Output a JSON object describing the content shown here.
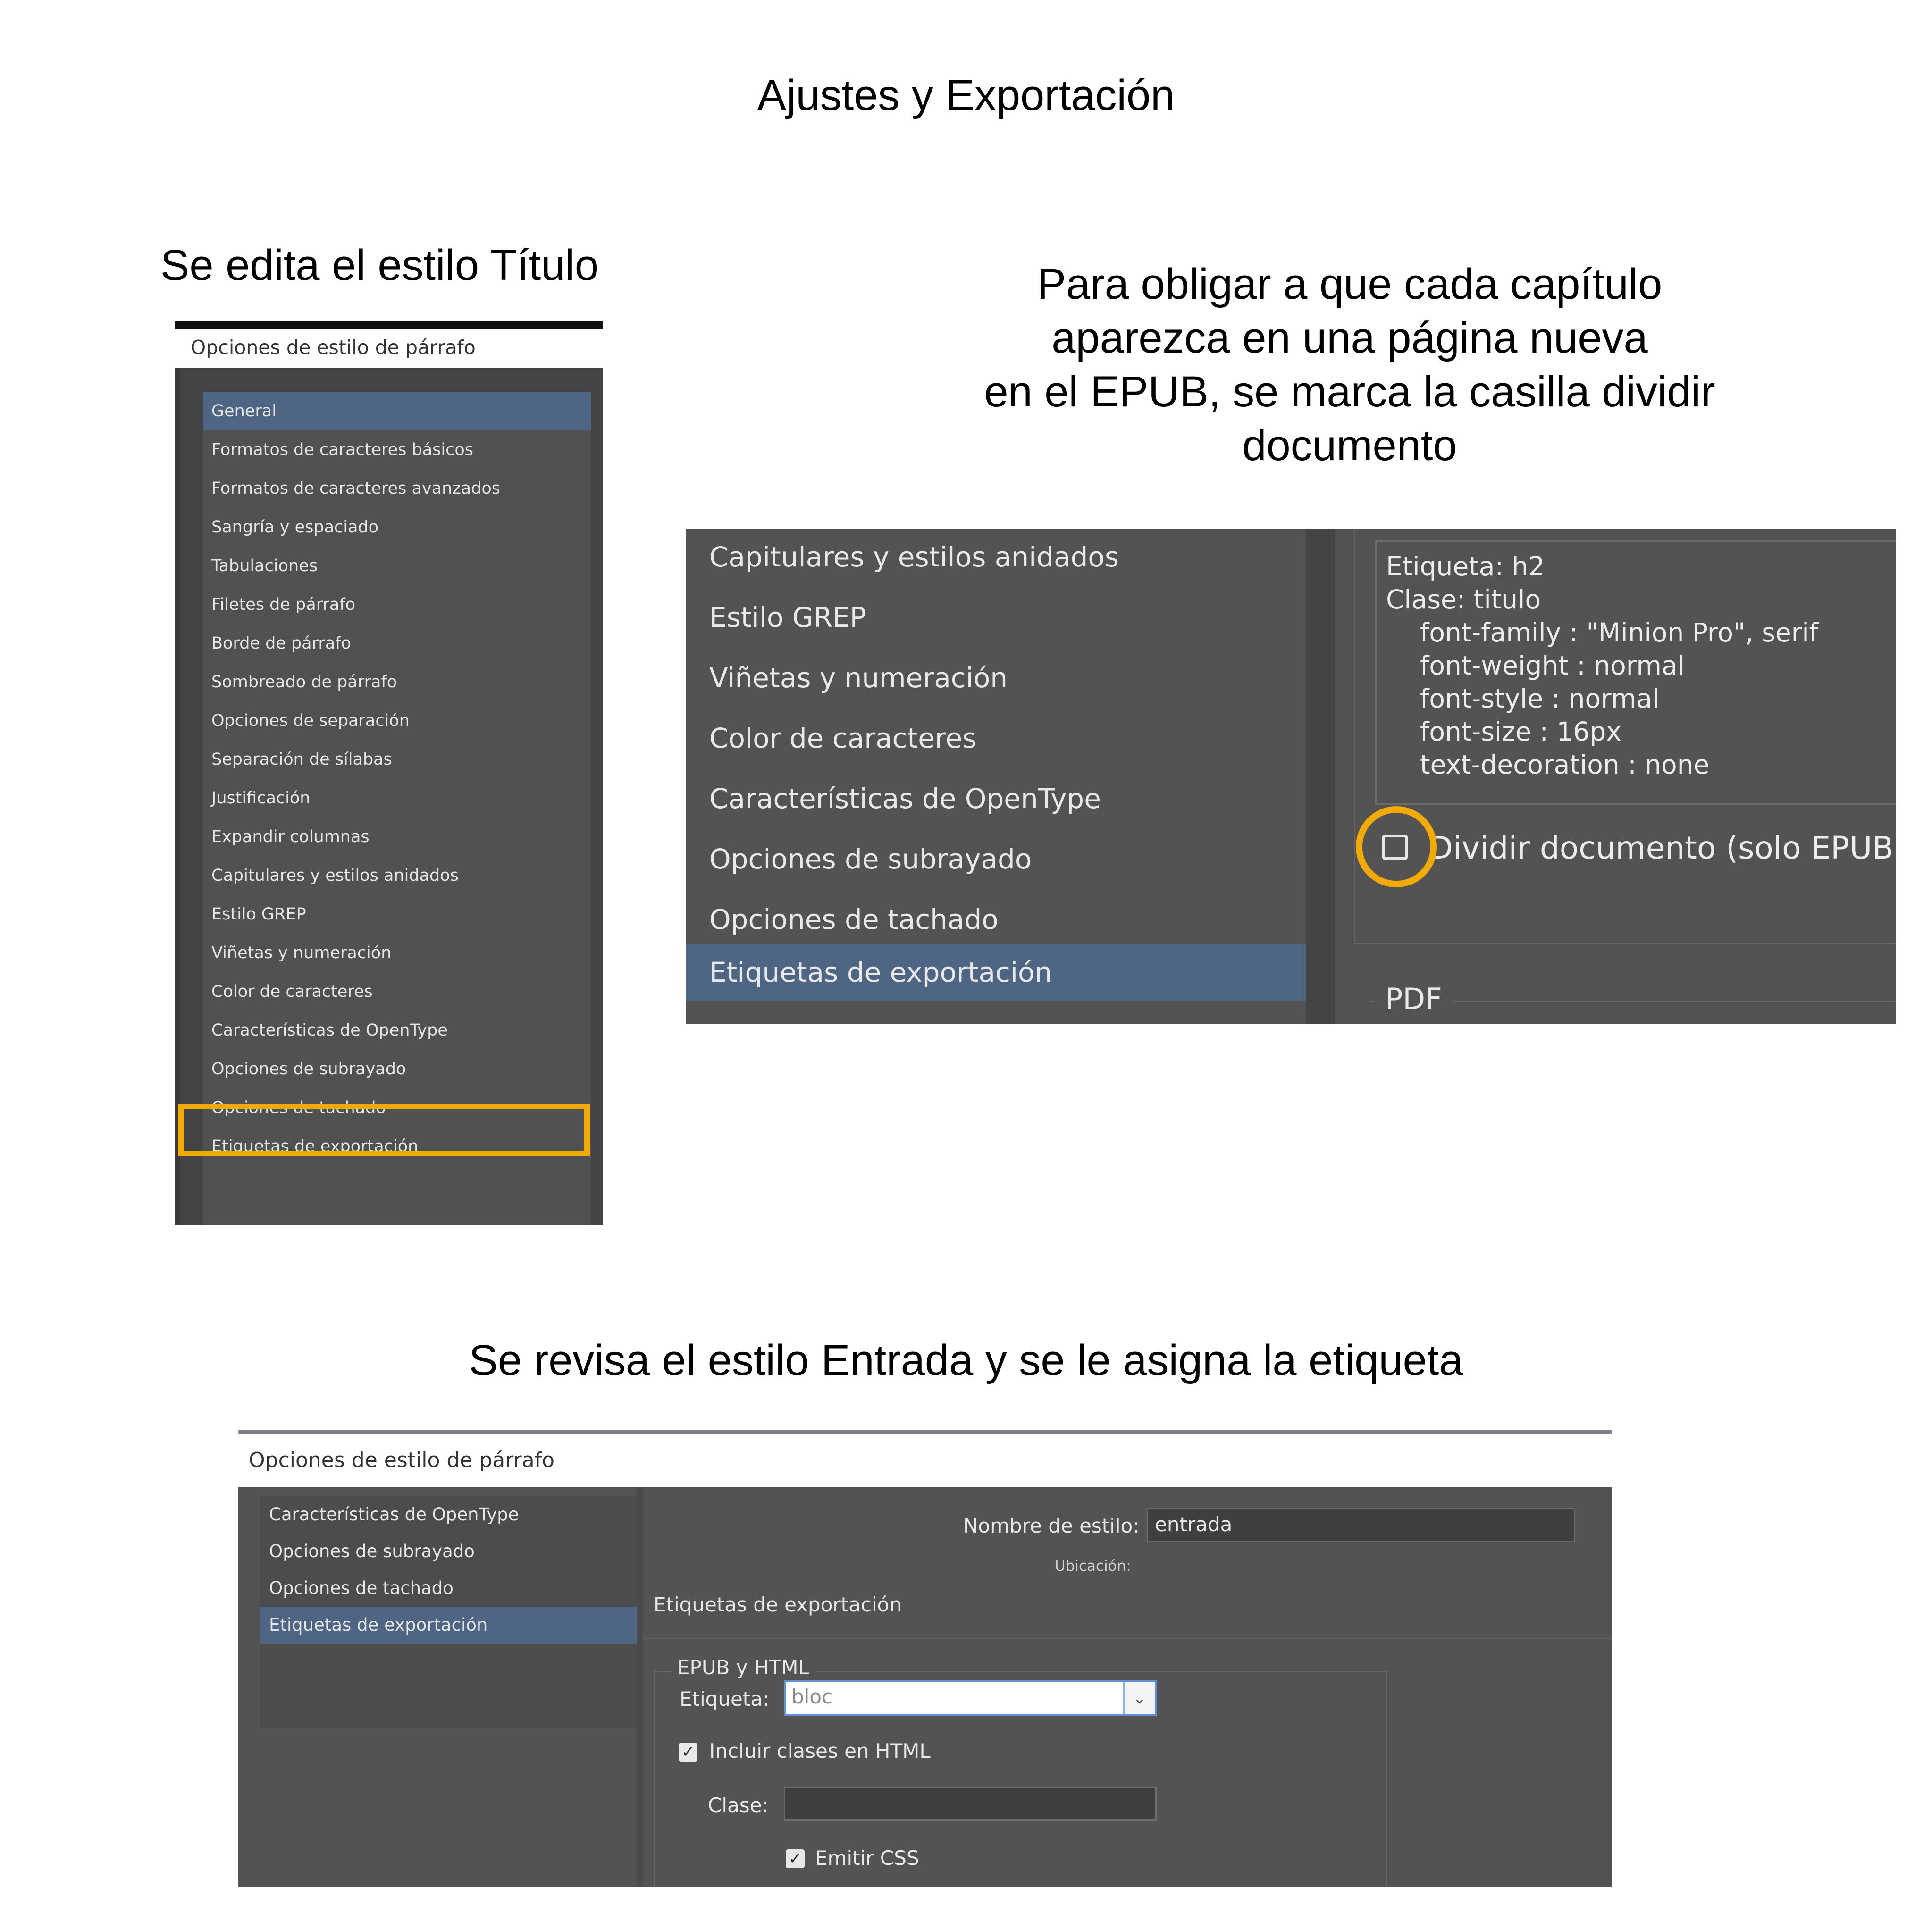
{
  "captions": {
    "main_title": "Ajustes y Exportación",
    "caption1": "Se edita el estilo Título",
    "caption2_lines": [
      "Para obligar a que cada capítulo",
      "aparezca en una página nueva",
      "en el EPUB, se marca la casilla dividir",
      "documento"
    ],
    "caption3": "Se revisa el estilo Entrada y se le asigna la etiqueta"
  },
  "panel1": {
    "title": "Opciones de estilo de párrafo",
    "items": [
      "General",
      "Formatos de caracteres básicos",
      "Formatos de caracteres avanzados",
      "Sangría y espaciado",
      "Tabulaciones",
      "Filetes de párrafo",
      "Borde de párrafo",
      "Sombreado de párrafo",
      "Opciones de separación",
      "Separación de sílabas",
      "Justificación",
      "Expandir columnas",
      "Capitulares y estilos anidados",
      "Estilo GREP",
      "Viñetas y numeración",
      "Color de caracteres",
      "Características de OpenType",
      "Opciones de subrayado",
      "Opciones de tachado",
      "Etiquetas de exportación"
    ],
    "selected_index": 0,
    "highlighted_index": 19
  },
  "panel2": {
    "nav_items": [
      "Capitulares y estilos anidados",
      "Estilo GREP",
      "Viñetas y numeración",
      "Color de caracteres",
      "Características de OpenType",
      "Opciones de subrayado",
      "Opciones de tachado",
      "Etiquetas de exportación"
    ],
    "selected_index": 7,
    "css_lines": [
      "Etiqueta: h2",
      "Clase: titulo",
      "font-family : \"Minion Pro\", serif",
      "font-weight : normal",
      "font-style : normal",
      "font-size : 16px",
      "text-decoration : none"
    ],
    "split_label": "Dividir documento (solo EPUB)",
    "split_checked": false,
    "pdf_label": "PDF"
  },
  "panel3": {
    "title": "Opciones de estilo de párrafo",
    "nav_items": [
      "Características de OpenType",
      "Opciones de subrayado",
      "Opciones de tachado",
      "Etiquetas de exportación"
    ],
    "selected_index": 3,
    "style_name_label": "Nombre de estilo:",
    "style_name_value": "entrada",
    "location_label": "Ubicación:",
    "section_title": "Etiquetas de exportación",
    "group_title": "EPUB y HTML",
    "tag_label": "Etiqueta:",
    "tag_value": "bloc",
    "include_classes_label": "Incluir clases en HTML",
    "include_classes_checked": true,
    "class_label": "Clase:",
    "class_value": "",
    "emit_css_label": "Emitir CSS",
    "emit_css_checked": true
  },
  "colors": {
    "highlight": "#f2a900",
    "dialog_bg": "#535353",
    "selected_item": "#4e6583"
  }
}
